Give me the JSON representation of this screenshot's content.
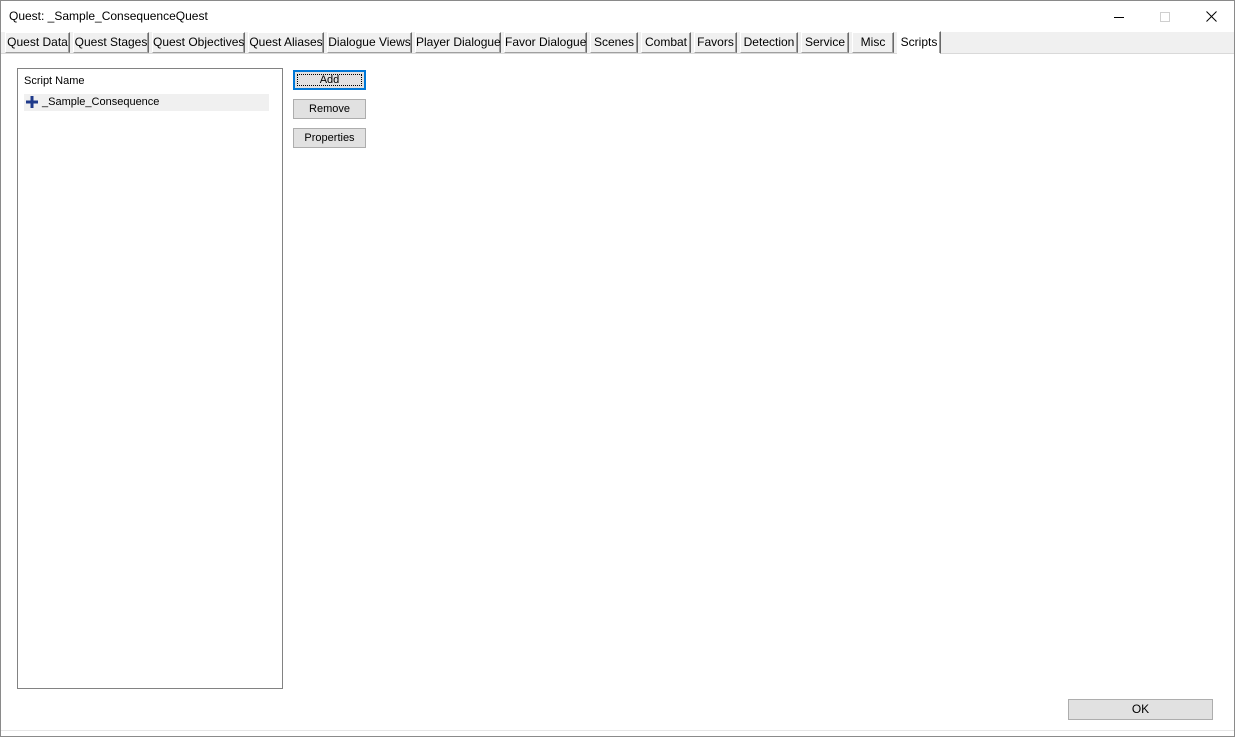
{
  "window": {
    "title": "Quest: _Sample_ConsequenceQuest",
    "controls": {
      "minimize_icon": "minimize-icon",
      "maximize_icon": "maximize-icon",
      "close_icon": "close-icon"
    }
  },
  "tabs": [
    {
      "label": "Quest Data",
      "active": false
    },
    {
      "label": "Quest Stages",
      "active": false
    },
    {
      "label": "Quest Objectives",
      "active": false
    },
    {
      "label": "Quest Aliases",
      "active": false
    },
    {
      "label": "Dialogue Views",
      "active": false
    },
    {
      "label": "Player Dialogue",
      "active": false
    },
    {
      "label": "Favor Dialogue",
      "active": false
    },
    {
      "label": "Scenes",
      "active": false
    },
    {
      "label": "Combat",
      "active": false
    },
    {
      "label": "Favors",
      "active": false
    },
    {
      "label": "Detection",
      "active": false
    },
    {
      "label": "Service",
      "active": false
    },
    {
      "label": "Misc",
      "active": false
    },
    {
      "label": "Scripts",
      "active": true
    }
  ],
  "scripts": {
    "column_header": "Script Name",
    "items": [
      {
        "name": "_Sample_Consequence",
        "icon": "plus-icon",
        "icon_color": "#1f3a8a"
      }
    ],
    "buttons": {
      "add": "Add",
      "remove": "Remove",
      "properties": "Properties"
    }
  },
  "footer": {
    "ok": "OK"
  },
  "colors": {
    "focus_accent": "#0078d7",
    "button_face": "#e1e1e1"
  }
}
